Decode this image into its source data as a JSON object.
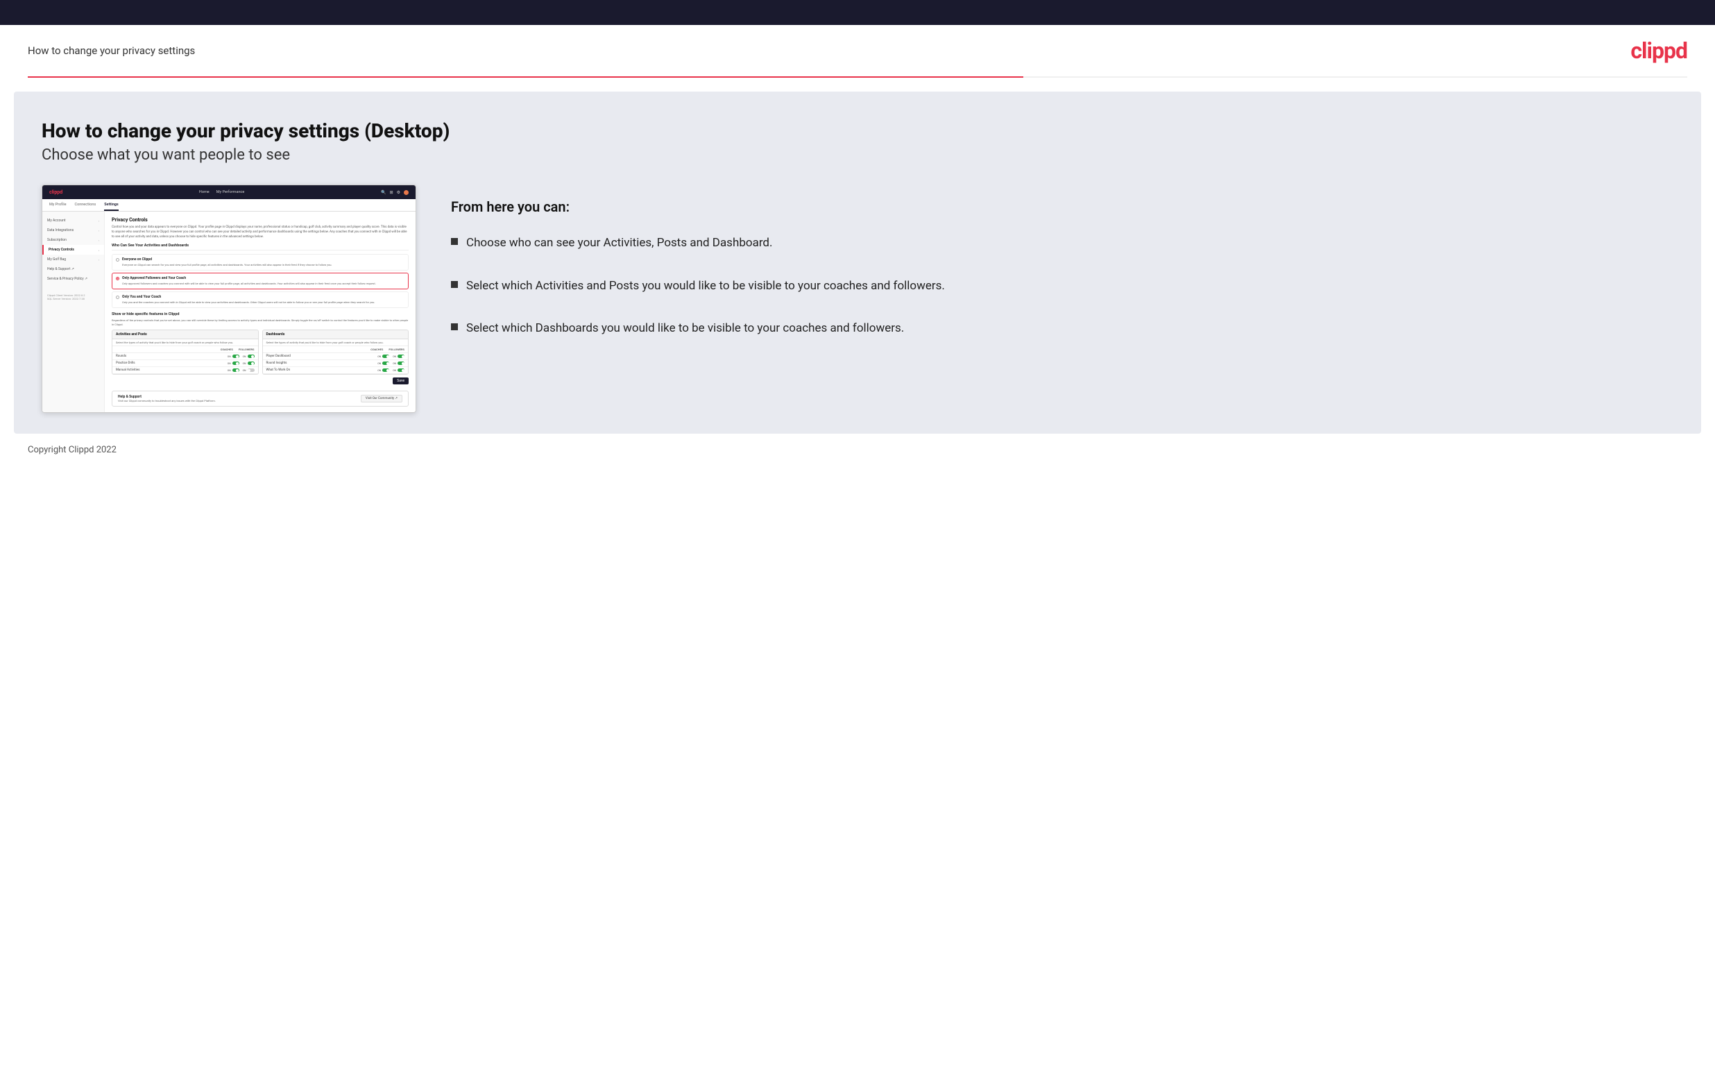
{
  "header": {
    "title": "How to change your privacy settings",
    "logo": "clippd"
  },
  "page": {
    "heading": "How to change your privacy settings (Desktop)",
    "subheading": "Choose what you want people to see"
  },
  "info_panel": {
    "intro": "From here you can:",
    "bullets": [
      "Choose who can see your Activities, Posts and Dashboard.",
      "Select which Activities and Posts you would like to be visible to your coaches and followers.",
      "Select which Dashboards you would like to be visible to your coaches and followers."
    ]
  },
  "mock": {
    "navbar": {
      "logo": "clippd",
      "links": [
        "Home",
        "My Performance"
      ]
    },
    "tabs": [
      "My Profile",
      "Connections",
      "Settings"
    ],
    "sidebar": {
      "items": [
        {
          "label": "My Account",
          "active": false
        },
        {
          "label": "Data Integrations",
          "active": false
        },
        {
          "label": "Subscription",
          "active": false
        },
        {
          "label": "Privacy Controls",
          "active": true
        },
        {
          "label": "My Golf Bag",
          "active": false
        },
        {
          "label": "Help & Support",
          "active": false
        },
        {
          "label": "Service & Privacy Policy",
          "active": false
        }
      ],
      "version": "Clippd Client Version: 2022.8.2\nSQL Server Version: 2022.7.38"
    },
    "panel": {
      "title": "Privacy Controls",
      "description": "Control how you and your data appears to everyone on Clippd. Your profile page in Clippd displays your name, professional status or handicap, golf club, activity summary and player quality score. This data is visible to anyone who searches for you in Clippd. However you can control who can see your detailed activity and performance dashboards using the settings below. Any coaches that you connect with in Clippd will be able to see all of your activity and data, unless you choose to hide specific features in the advanced settings below.",
      "who_can_see_title": "Who Can See Your Activities and Dashboards",
      "radio_options": [
        {
          "label": "Everyone on Clippd",
          "desc": "Everyone on Clippd can search for you and view your full profile page, all activities and dashboards. Your activities will also appear in their feed if they choose to follow you.",
          "selected": false
        },
        {
          "label": "Only Approved Followers and Your Coach",
          "desc": "Only approved followers and coaches you connect with will be able to view your full profile page, all activities and dashboards. Your activities will also appear in their feed once you accept their follow request.",
          "selected": true
        },
        {
          "label": "Only You and Your Coach",
          "desc": "Only you and the coaches you connect with in Clippd will be able to view your activities and dashboards. Other Clippd users will not be able to follow you or see your full profile page when they search for you.",
          "selected": false
        }
      ],
      "show_hide_title": "Show or hide specific features in Clippd",
      "show_hide_desc": "Regardless of the privacy controls that you've set above, you can still override these by limiting access to activity types and individual dashboards. Simply toggle the on/off switch to control the features you'd like to make visible to other people in Clippd.",
      "activities_table": {
        "title": "Activities and Posts",
        "desc": "Select the types of activity that you'd like to hide from your golf coach or people who follow you.",
        "col_coaches": "COACHES",
        "col_followers": "FOLLOWERS",
        "rows": [
          {
            "label": "Rounds",
            "coaches": "ON",
            "followers": "ON"
          },
          {
            "label": "Practice Drills",
            "coaches": "ON",
            "followers": "ON"
          },
          {
            "label": "Manual Activities",
            "coaches": "ON",
            "followers": "OFF"
          }
        ]
      },
      "dashboards_table": {
        "title": "Dashboards",
        "desc": "Select the types of activity that you'd like to hide from your golf coach or people who follow you.",
        "col_coaches": "COACHES",
        "col_followers": "FOLLOWERS",
        "rows": [
          {
            "label": "Player Dashboard",
            "coaches": "ON",
            "followers": "ON"
          },
          {
            "label": "Round Insights",
            "coaches": "ON",
            "followers": "ON"
          },
          {
            "label": "What To Work On",
            "coaches": "ON",
            "followers": "ON"
          }
        ]
      },
      "save_button": "Save",
      "help_section": {
        "title": "Help & Support",
        "desc": "Visit our Clippd community to troubleshoot any issues with the Clippd Platform.",
        "button": "Visit Our Community"
      }
    }
  },
  "footer": {
    "text": "Copyright Clippd 2022"
  }
}
